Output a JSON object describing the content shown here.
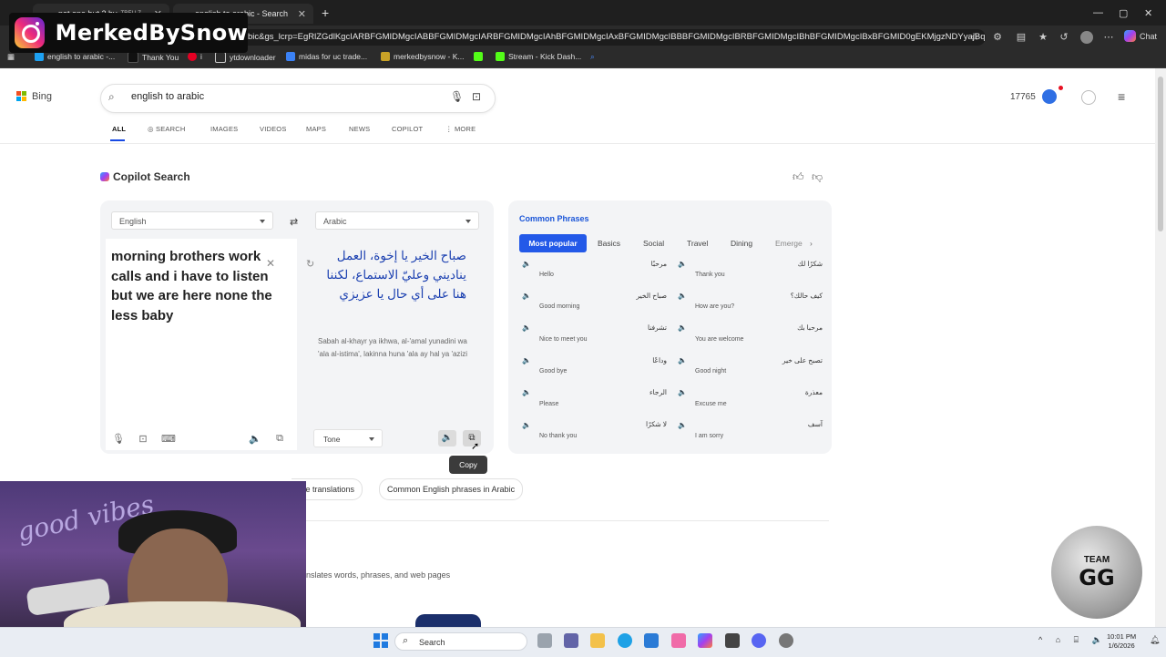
{
  "browser": {
    "tabs": [
      {
        "label": "not one but 2 by",
        "badge": "TRELLZ"
      },
      {
        "label": "english to arabic - Search"
      }
    ],
    "address": "bic&gs_lcrp=EgRlZGdlKgcIARBFGMIDMgcIABBFGMIDMgcIARBFGMIDMgcIAhBFGMIDMgcIAxBFGMIDMgcIBBBFGMIDMgcIBRBFGMIDMgcIBhBFGMIDMgcIBxBFGMID0gEKMjgzNDYyajBqMa...",
    "favorites": [
      {
        "label": "english to arabic -...",
        "icon": "bing-icon",
        "color": "#1da1f2"
      },
      {
        "label": "Thank You",
        "icon": "tiktok-icon",
        "color": "#111111"
      },
      {
        "label": "i",
        "icon": "pinterest-icon",
        "color": "#e60023"
      },
      {
        "label": "ytdownloader",
        "icon": "folder-icon",
        "color": "#f0c14b"
      },
      {
        "label": "midas for uc trade...",
        "icon": "site-icon",
        "color": "#3b82f6"
      },
      {
        "label": "merkedbysnow - K...",
        "icon": "star-icon",
        "color": "#c9a227"
      },
      {
        "label": "",
        "icon": "kick-icon",
        "color": "#53fc18"
      },
      {
        "label": "Stream - Kick Dash...",
        "icon": "kick-icon",
        "color": "#53fc18"
      },
      {
        "label": "",
        "icon": "search-icon",
        "color": "#4a8cff"
      }
    ],
    "chat_label": "Chat"
  },
  "overlay": {
    "brand_name": "MerkedBySnow"
  },
  "bing": {
    "logo_text": "Bing",
    "query": "english to arabic",
    "nav": [
      "ALL",
      "SEARCH",
      "IMAGES",
      "VIDEOS",
      "MAPS",
      "NEWS",
      "COPILOT",
      "MORE"
    ],
    "points": "17765",
    "copilot_title": "Copilot Search"
  },
  "translator": {
    "source_lang": "English",
    "target_lang": "Arabic",
    "source_text": "morning brothers work calls and i have to listen but we are here none the less baby",
    "target_text": "صباح الخير يا إخوة، العمل يناديني وعليّ الاستماع، لكننا هنا على أي حال يا عزيزي",
    "transliteration": "Sabah al-khayr ya ikhwa, al-'amal yunadini wa 'ala al-istima', lakinna huna 'ala ay hal ya 'azizi",
    "tone_label": "Tone",
    "copy_tooltip": "Copy"
  },
  "phrases": {
    "title": "Common Phrases",
    "tabs": [
      "Most popular",
      "Basics",
      "Social",
      "Travel",
      "Dining",
      "Emerge"
    ],
    "items": [
      {
        "ar": "مرحبًا",
        "en": "Hello"
      },
      {
        "ar": "شكرًا لك",
        "en": "Thank you"
      },
      {
        "ar": "صباح الخير",
        "en": "Good morning"
      },
      {
        "ar": "كيف حالك؟",
        "en": "How are you?"
      },
      {
        "ar": "تشرفنا",
        "en": "Nice to meet you"
      },
      {
        "ar": "مرحبا بك",
        "en": "You are welcome"
      },
      {
        "ar": "وداعًا",
        "en": "Good bye"
      },
      {
        "ar": "تصبح على خير",
        "en": "Good night"
      },
      {
        "ar": "الرجاء",
        "en": "Please"
      },
      {
        "ar": "معذرة",
        "en": "Excuse me"
      },
      {
        "ar": "لا شكرًا",
        "en": "No thank you"
      },
      {
        "ar": "آسف",
        "en": "I am sorry"
      }
    ]
  },
  "below": {
    "chips": [
      "ate translations",
      "Common English phrases in Arabic"
    ],
    "description": "nslates words, phrases, and web pages"
  },
  "badge": {
    "top": "TEAM",
    "main": "GG"
  },
  "taskbar": {
    "search_label": "Search",
    "time": "10:01 PM",
    "date": "1/6/2026"
  },
  "colors": {
    "accent": "#2359e8",
    "translation_text": "#1a3fb0",
    "chrome_dark": "#1f1f1f"
  }
}
